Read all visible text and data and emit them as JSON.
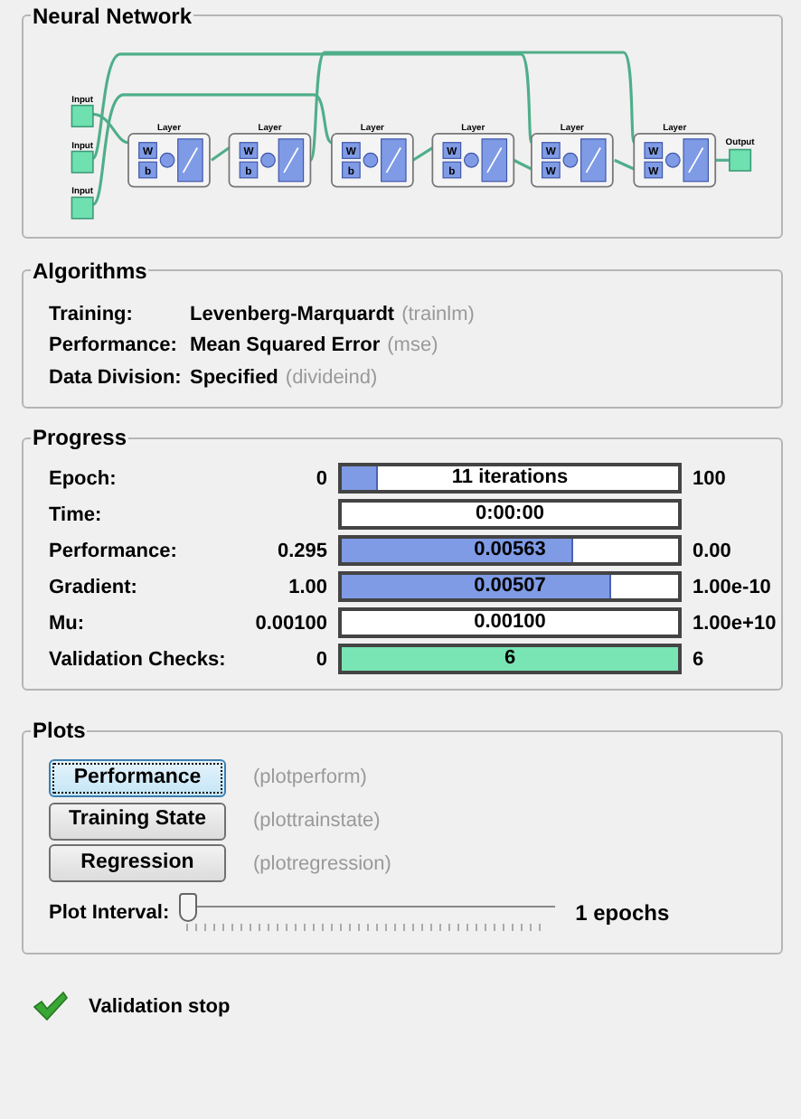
{
  "network": {
    "title": "Neural Network",
    "inputs": [
      "Input",
      "Input",
      "Input"
    ],
    "layers": [
      {
        "label": "Layer",
        "weights": [
          "W",
          "b"
        ]
      },
      {
        "label": "Layer",
        "weights": [
          "W",
          "b"
        ]
      },
      {
        "label": "Layer",
        "weights": [
          "W",
          "b"
        ]
      },
      {
        "label": "Layer",
        "weights": [
          "W",
          "b"
        ]
      },
      {
        "label": "Layer",
        "weights": [
          "W",
          "W"
        ]
      },
      {
        "label": "Layer",
        "weights": [
          "W",
          "W"
        ]
      }
    ],
    "output": "Output"
  },
  "algorithms": {
    "title": "Algorithms",
    "rows": [
      {
        "label": "Training:",
        "value": "Levenberg-Marquardt",
        "function": "(trainlm)"
      },
      {
        "label": "Performance:",
        "value": "Mean Squared Error",
        "function": "(mse)"
      },
      {
        "label": "Data Division:",
        "value": "Specified",
        "function": "(divideind)"
      }
    ]
  },
  "progress": {
    "title": "Progress",
    "rows": [
      {
        "kind": "measure",
        "label": "Epoch:",
        "start": "0",
        "reading": "11 iterations",
        "level": 0.11,
        "end": "100"
      },
      {
        "kind": "measure",
        "label": "Time:",
        "reading": "0:00:00",
        "level": 0
      },
      {
        "kind": "measure",
        "label": "Performance:",
        "start": "0.295",
        "reading": "0.00563",
        "level": 0.69,
        "end": "0.00"
      },
      {
        "kind": "measure",
        "label": "Gradient:",
        "start": "1.00",
        "reading": "0.00507",
        "level": 0.8,
        "end": "1.00e-10"
      },
      {
        "kind": "measure",
        "label": "Mu:",
        "start": "0.00100",
        "reading": "0.00100",
        "level": 0,
        "end": "1.00e+10"
      },
      {
        "kind": "checks",
        "label": "Validation Checks:",
        "start": "0",
        "reading": "6",
        "level": 1,
        "end": "6"
      }
    ]
  },
  "plots": {
    "title": "Plots",
    "buttons": [
      {
        "label": "Performance",
        "function": "(plotperform)",
        "selected": true
      },
      {
        "label": "Training State",
        "function": "(plottrainstate)",
        "selected": false
      },
      {
        "label": "Regression",
        "function": "(plotregression)",
        "selected": false
      }
    ],
    "interval": {
      "label": "Plot Interval:",
      "level": 0,
      "reading": "1 epochs"
    }
  },
  "status": {
    "text": "Validation stop"
  }
}
